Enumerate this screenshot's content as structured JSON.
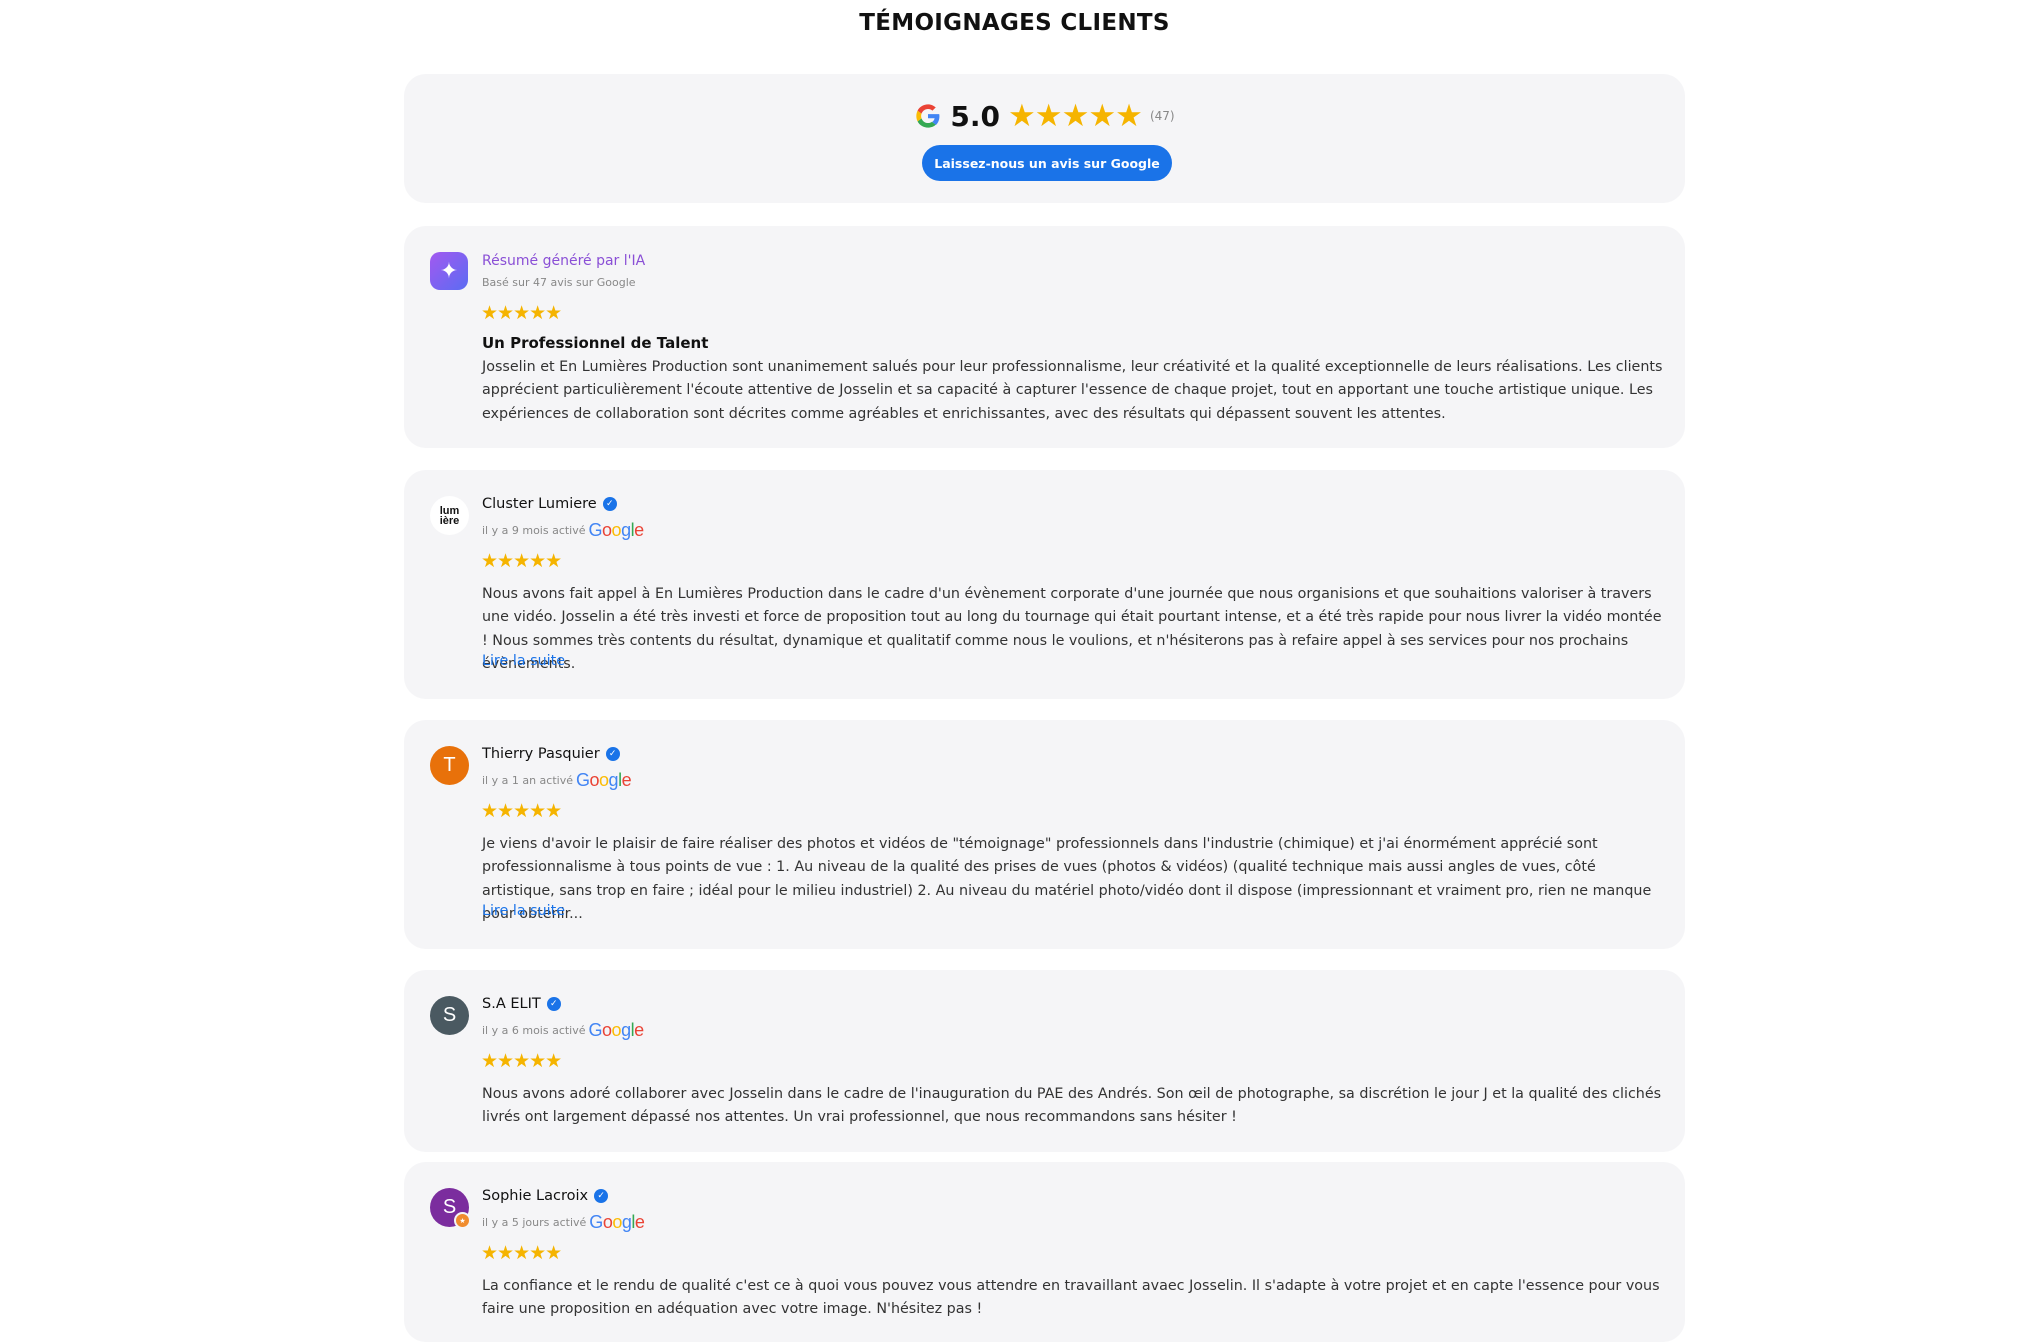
{
  "page_title": "TÉMOIGNAGES CLIENTS",
  "summary": {
    "rating": "5.0",
    "stars": "★★★★★",
    "count": "(47)",
    "button_label": "Laissez-nous un avis sur Google",
    "google_g": "G",
    "colors": {
      "button": "#1a73e8",
      "stars": "#f5b400"
    }
  },
  "ai_summary": {
    "icon": "sparkle-icon",
    "icon_glyph": "✦",
    "title": "Résumé généré par l'IA",
    "subtitle": "Basé sur 47 avis sur Google",
    "stars": "★★★★★",
    "heading": "Un Professionnel de Talent",
    "text": "Josselin et En Lumières Production sont unanimement salués pour leur professionnalisme, leur créativité et la qualité exceptionnelle de leurs réalisations. Les clients apprécient particulièrement l'écoute attentive de Josselin et sa capacité à capturer l'essence de chaque projet, tout en apportant une touche artistique unique. Les expériences de collaboration sont décrites comme agréables et enrichissantes, avec des résultats qui dépassent souvent les attentes."
  },
  "reviews": [
    {
      "name": "Cluster Lumiere",
      "avatar_letter": "lum\nière",
      "avatar_color": "#ffffff",
      "time": "il y a 9 mois activé",
      "stars": "★★★★★",
      "text": "Nous avons fait appel à En Lumières Production dans le cadre d'un évènement corporate d'une journée que nous organisions et que souhaitions valoriser à travers une vidéo. Josselin a été très investi et force de proposition tout au long du tournage qui était pourtant intense, et a été très rapide pour nous livrer la vidéo montée ! Nous sommes très contents du résultat, dynamique et qualitatif comme nous le voulions, et n'hésiterons pas à refaire appel à ses services pour nos prochains évènements.",
      "read_more": "Lire la suite"
    },
    {
      "name": "Thierry Pasquier",
      "avatar_letter": "T",
      "avatar_color": "#e8710a",
      "time": "il y a 1 an activé",
      "stars": "★★★★★",
      "text": "Je viens d'avoir le plaisir de faire réaliser des photos et vidéos de \"témoignage\" professionnels dans l'industrie (chimique) et j'ai énormément apprécié sont professionnalisme à tous points de vue : 1. Au niveau de la qualité des prises de vues (photos & vidéos) (qualité technique mais aussi angles de vues, côté artistique, sans trop en faire ; idéal pour le milieu industriel) 2. Au niveau du matériel photo/vidéo dont il dispose (impressionnant et vraiment pro, rien ne manque pour obtenir...",
      "read_more": "Lire la suite"
    },
    {
      "name": "S.A ELIT",
      "avatar_letter": "S",
      "avatar_color": "#4a5961",
      "time": "il y a 6 mois activé",
      "stars": "★★★★★",
      "text": "Nous avons adoré collaborer avec Josselin dans le cadre de l'inauguration du PAE des Andrés. Son œil de photographe, sa discrétion le jour J et la qualité des clichés livrés ont largement dépassé nos attentes. Un vrai professionnel, que nous recommandons sans hésiter !",
      "read_more": ""
    },
    {
      "name": "Sophie Lacroix",
      "avatar_letter": "S",
      "avatar_color": "#7b2d9e",
      "time": "il y a 5 jours activé",
      "stars": "★★★★★",
      "text": "La confiance et le rendu de qualité c'est ce à quoi vous pouvez vous attendre en travaillant avaec Josselin. Il s'adapte à votre projet et en capte l'essence pour vous faire une proposition en adéquation avec votre image. N'hésitez pas !",
      "read_more": ""
    }
  ],
  "google_word": {
    "g1": "G",
    "o1": "o",
    "o2": "o",
    "g2": "g",
    "l": "l",
    "e": "e"
  }
}
